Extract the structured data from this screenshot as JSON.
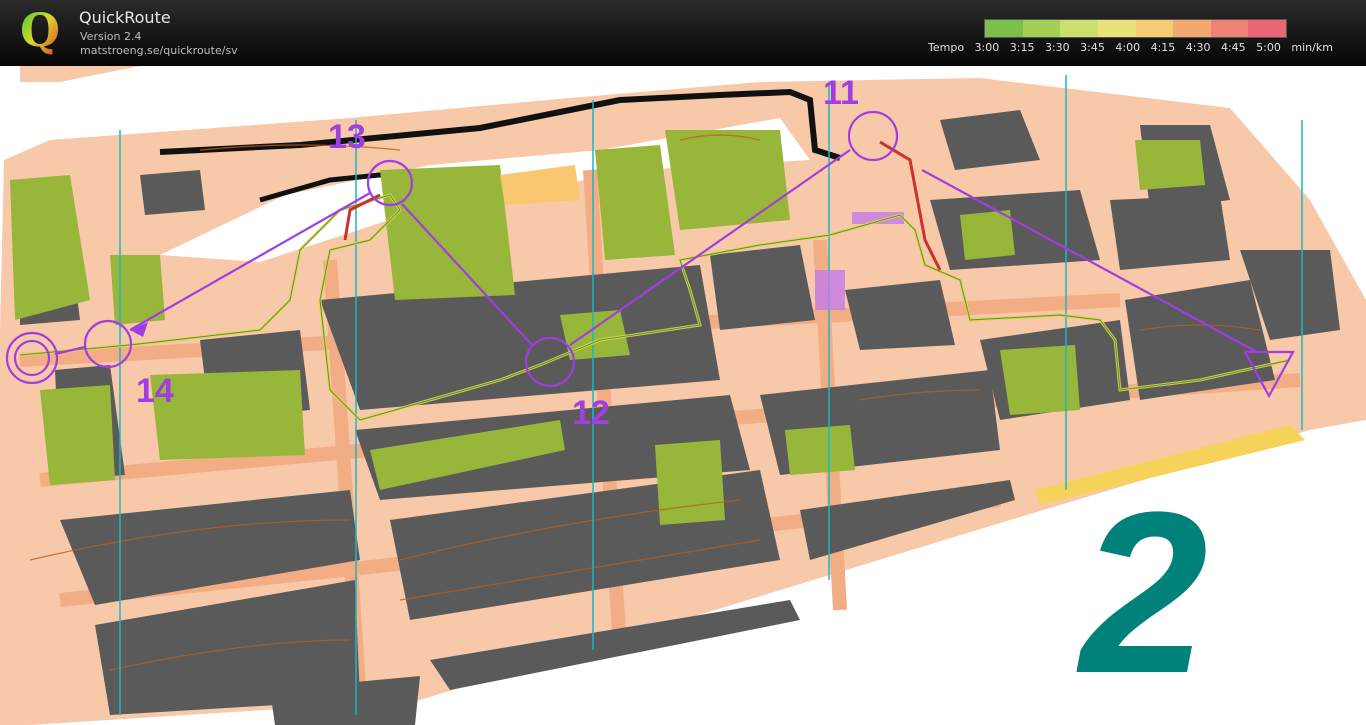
{
  "app": {
    "title": "QuickRoute",
    "version": "Version 2.4",
    "url": "matstroeng.se/quickroute/sv",
    "logo_letter": "Q"
  },
  "legend": {
    "label": "Tempo",
    "ticks": [
      "3:00",
      "3:15",
      "3:30",
      "3:45",
      "4:00",
      "4:15",
      "4:30",
      "4:45",
      "5:00"
    ],
    "unit": "min/km",
    "colors": [
      "#7bc04b",
      "#a5cf54",
      "#cbe06a",
      "#e8e377",
      "#f4cd72",
      "#f3a96f",
      "#ee8275",
      "#e96676"
    ]
  },
  "map": {
    "controls": [
      "11",
      "12",
      "13",
      "14"
    ],
    "big_label": "2",
    "course_color": "#a03ee0",
    "colors": {
      "paved": "#f7c9a9",
      "building": "#5a5a5a",
      "vegetation": "#97b63a",
      "road": "#f2ad85",
      "contour": "#b85f1a",
      "north_lines": "#19b8c4",
      "big_label": "#00827a"
    }
  }
}
